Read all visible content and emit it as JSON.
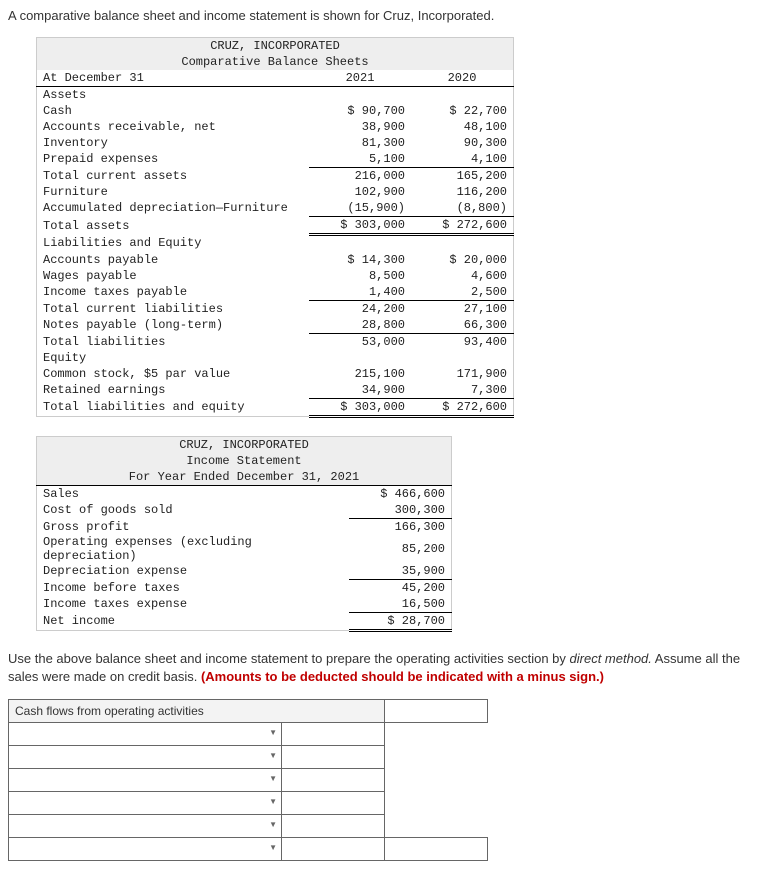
{
  "intro": "A comparative balance sheet and income statement is shown for Cruz, Incorporated.",
  "balance_sheet": {
    "company": "CRUZ, INCORPORATED",
    "title": "Comparative Balance Sheets",
    "col_label": "At December 31",
    "col1": "2021",
    "col2": "2020",
    "sections": {
      "assets_hdr": "Assets",
      "liab_hdr": "Liabilities and Equity",
      "equity_hdr": "Equity"
    },
    "rows": [
      {
        "label": "Cash",
        "v1": "$ 90,700",
        "v2": "$ 22,700"
      },
      {
        "label": "Accounts receivable, net",
        "v1": "38,900",
        "v2": "48,100"
      },
      {
        "label": "Inventory",
        "v1": "81,300",
        "v2": "90,300"
      },
      {
        "label": "Prepaid expenses",
        "v1": "5,100",
        "v2": "4,100"
      },
      {
        "label": "Total current assets",
        "v1": "216,000",
        "v2": "165,200"
      },
      {
        "label": "Furniture",
        "v1": "102,900",
        "v2": "116,200"
      },
      {
        "label": "Accumulated depreciation—Furniture",
        "v1": "(15,900)",
        "v2": "(8,800)"
      },
      {
        "label": "Total assets",
        "v1": "$ 303,000",
        "v2": "$ 272,600"
      },
      {
        "label": "Accounts payable",
        "v1": "$ 14,300",
        "v2": "$ 20,000"
      },
      {
        "label": "Wages payable",
        "v1": "8,500",
        "v2": "4,600"
      },
      {
        "label": "Income taxes payable",
        "v1": "1,400",
        "v2": "2,500"
      },
      {
        "label": "Total current liabilities",
        "v1": "24,200",
        "v2": "27,100"
      },
      {
        "label": "Notes payable (long-term)",
        "v1": "28,800",
        "v2": "66,300"
      },
      {
        "label": "Total liabilities",
        "v1": "53,000",
        "v2": "93,400"
      },
      {
        "label": "Common stock, $5 par value",
        "v1": "215,100",
        "v2": "171,900"
      },
      {
        "label": "Retained earnings",
        "v1": "34,900",
        "v2": "7,300"
      },
      {
        "label": "Total liabilities and equity",
        "v1": "$ 303,000",
        "v2": "$ 272,600"
      }
    ]
  },
  "income_statement": {
    "company": "CRUZ, INCORPORATED",
    "title": "Income Statement",
    "period": "For Year Ended December 31, 2021",
    "rows": [
      {
        "label": "Sales",
        "v": "$ 466,600"
      },
      {
        "label": "Cost of goods sold",
        "v": "300,300"
      },
      {
        "label": "Gross profit",
        "v": "166,300"
      },
      {
        "label": "Operating expenses (excluding depreciation)",
        "v": "85,200"
      },
      {
        "label": "Depreciation expense",
        "v": "35,900"
      },
      {
        "label": "Income before taxes",
        "v": "45,200"
      },
      {
        "label": "Income taxes expense",
        "v": "16,500"
      },
      {
        "label": "Net income",
        "v": "$ 28,700"
      }
    ]
  },
  "instructions": {
    "line1_a": "Use the above balance sheet and income statement to prepare the operating activities section by ",
    "line1_em": "direct method.",
    "line1_b": " Assume all the sales were made on credit basis. ",
    "line1_red": "(Amounts to be deducted should be indicated with a minus sign.)"
  },
  "answer": {
    "header": "Cash flows from operating activities"
  }
}
